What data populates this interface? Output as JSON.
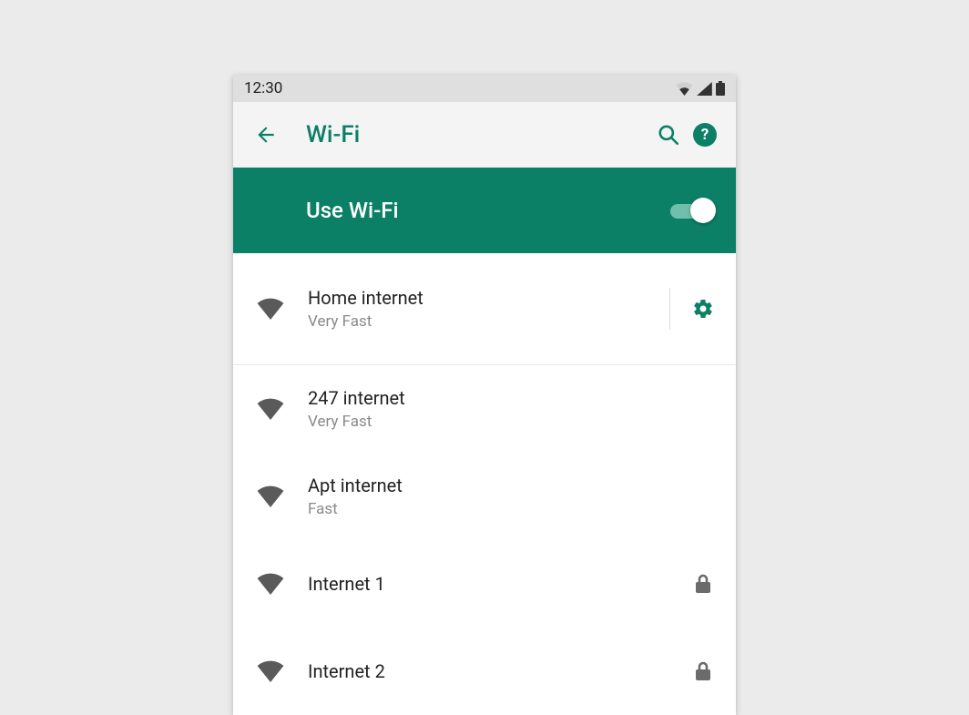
{
  "statusbar": {
    "time": "12:30"
  },
  "appbar": {
    "title": "Wi-Fi"
  },
  "banner": {
    "label": "Use Wi-Fi",
    "enabled": true
  },
  "colors": {
    "accent": "#0b8066",
    "muted": "#8a8a8a",
    "iconDark": "#5a5a5a"
  },
  "connected": {
    "name": "Home internet",
    "speed": "Very Fast"
  },
  "networks": [
    {
      "name": "247 internet",
      "speed": "Very Fast",
      "locked": false
    },
    {
      "name": "Apt internet",
      "speed": "Fast",
      "locked": false
    },
    {
      "name": "Internet 1",
      "speed": "",
      "locked": true
    },
    {
      "name": "Internet 2",
      "speed": "",
      "locked": true
    }
  ]
}
